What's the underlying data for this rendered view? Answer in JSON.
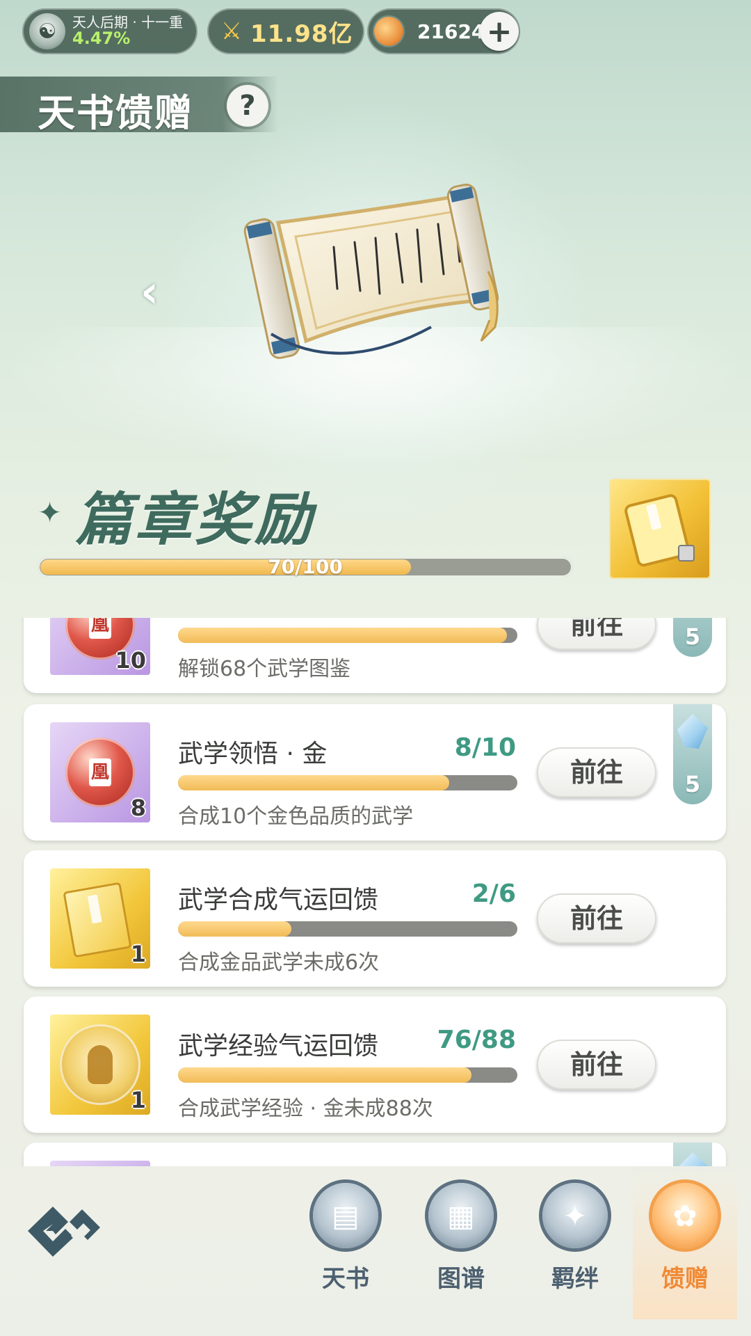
{
  "status_bar": {
    "rank_title": "天人后期 · 十一重",
    "rank_percent": "4.47%",
    "power": "11.98亿",
    "coins": "21624",
    "plus_icon": "plus-icon"
  },
  "header": {
    "title": "天书馈赠",
    "help": "?"
  },
  "hero": {
    "item_icon": "scroll-icon",
    "prev_arrow": "‹"
  },
  "chapter": {
    "title": "篇章奖励",
    "progress_text": "70/100",
    "progress_value": 70,
    "progress_max": 100,
    "reward_icon": "golden-book-icon"
  },
  "tasks": [
    {
      "name": "",
      "progress": "",
      "fraction": 0.97,
      "desc": "解锁68个武学图鉴",
      "count": "10",
      "icon": "red-orb-icon",
      "button": "前往",
      "bonus": "5"
    },
    {
      "name": "武学领悟 · 金",
      "progress": "8/10",
      "fraction": 0.8,
      "desc": "合成10个金色品质的武学",
      "count": "8",
      "icon": "red-orb-icon",
      "button": "前往",
      "bonus": "5"
    },
    {
      "name": "武学合成气运回馈",
      "progress": "2/6",
      "fraction": 0.333,
      "desc": "合成金品武学未成6次",
      "count": "1",
      "icon": "golden-book-icon",
      "button": "前往"
    },
    {
      "name": "武学经验气运回馈",
      "progress": "76/88",
      "fraction": 0.864,
      "desc": "合成武学经验 · 金未成88次",
      "count": "1",
      "icon": "meditating-figure-icon",
      "button": "前往"
    }
  ],
  "nav": {
    "items": [
      {
        "label": "天书",
        "icon": "book-icon"
      },
      {
        "label": "图谱",
        "icon": "map-icon"
      },
      {
        "label": "羁绊",
        "icon": "handshake-icon"
      },
      {
        "label": "馈赠",
        "icon": "gift-bag-icon"
      }
    ],
    "active_index": 3
  },
  "colors": {
    "accent_green": "#3f9a83",
    "progress_gold": "#f1bb57",
    "active_orange": "#f08a36"
  }
}
